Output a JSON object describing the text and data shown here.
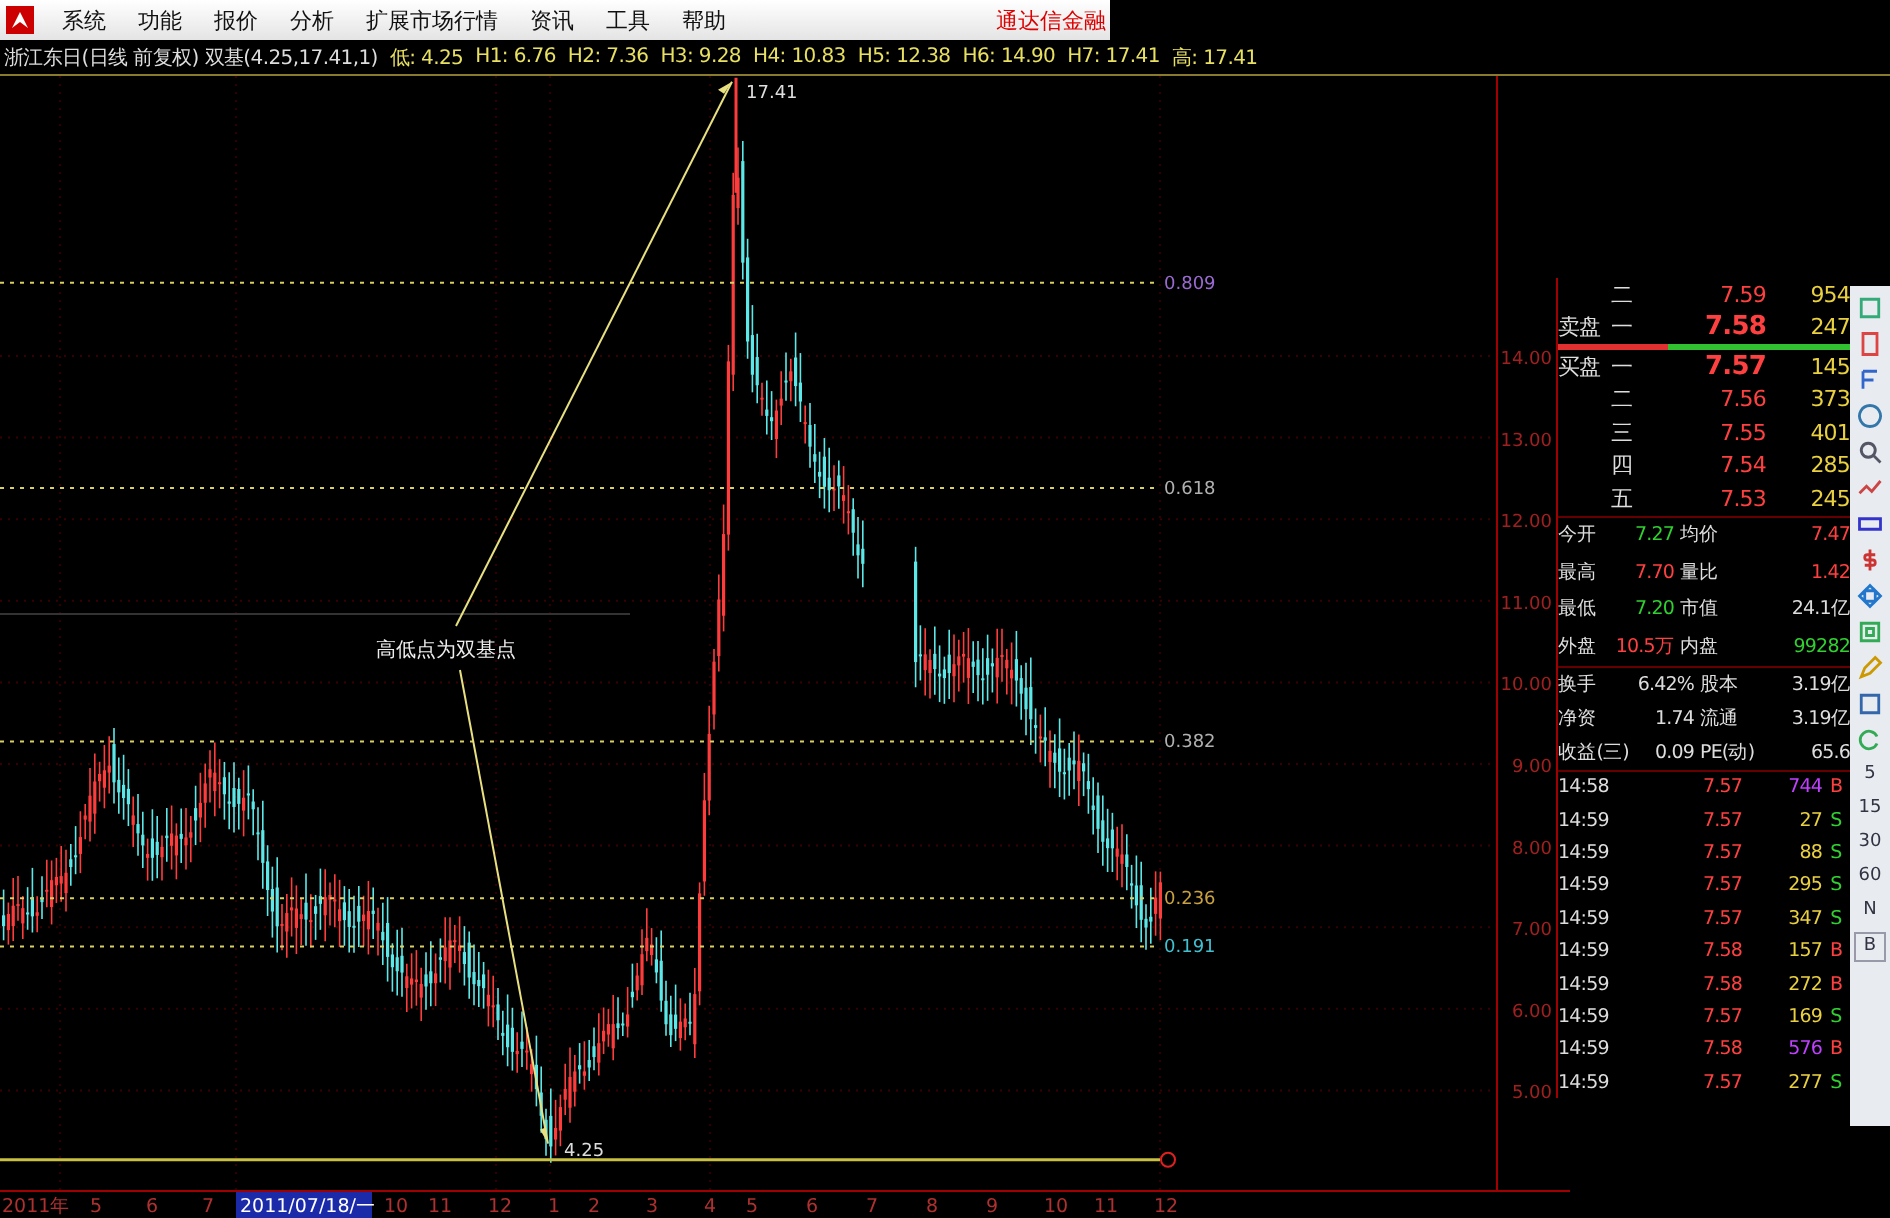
{
  "menu": {
    "items": [
      "系统",
      "功能",
      "报价",
      "分析",
      "扩展市场行情",
      "资讯",
      "工具",
      "帮助"
    ],
    "brand": "通达信金融"
  },
  "info_line": [
    {
      "kind": "title",
      "text": "浙江东日(日线 前复权) 双基(4.25,17.41,1)"
    },
    {
      "kind": "level",
      "text": "低: 4.25"
    },
    {
      "kind": "level",
      "text": "H1: 6.76"
    },
    {
      "kind": "level",
      "text": "H2: 7.36"
    },
    {
      "kind": "level",
      "text": "H3: 9.28"
    },
    {
      "kind": "level",
      "text": "H4: 10.83"
    },
    {
      "kind": "level",
      "text": "H5: 12.38"
    },
    {
      "kind": "level",
      "text": "H6: 14.90"
    },
    {
      "kind": "level",
      "text": "H7: 17.41"
    },
    {
      "kind": "level",
      "text": "高: 17.41"
    }
  ],
  "chart": {
    "high_label": "17.41",
    "low_label": "4.25",
    "annotation": "高低点为双基点",
    "fib_levels": [
      {
        "label": "0.809",
        "color": "#9a6ad0"
      },
      {
        "label": "0.618",
        "color": "#b0b0b0"
      },
      {
        "label": "0.382",
        "color": "#b0b0b0"
      },
      {
        "label": "0.236",
        "color": "#c8a040"
      },
      {
        "label": "0.191",
        "color": "#40c0d0"
      }
    ],
    "price_ticks": [
      "14.00",
      "13.00",
      "12.00",
      "11.00",
      "10.00",
      "9.00",
      "8.00",
      "7.00",
      "6.00",
      "5.00"
    ]
  },
  "order_book": [
    {
      "level": "二",
      "price": "7.59",
      "volume": "954",
      "best": false
    },
    {
      "side_label": "卖盘",
      "level": "一",
      "price": "7.58",
      "volume": "247",
      "best": true
    },
    {
      "side_label": "买盘",
      "level": "一",
      "price": "7.57",
      "volume": "145",
      "best": true
    },
    {
      "level": "二",
      "price": "7.56",
      "volume": "373",
      "best": false
    },
    {
      "level": "三",
      "price": "7.55",
      "volume": "401",
      "best": false
    },
    {
      "level": "四",
      "price": "7.54",
      "volume": "285",
      "best": false
    },
    {
      "level": "五",
      "price": "7.53",
      "volume": "245",
      "best": false
    }
  ],
  "stats": [
    [
      {
        "label": "今开",
        "value": "7.27",
        "color": "#30d030"
      },
      {
        "label": "均价",
        "value": "7.47",
        "color": "#ff4040"
      }
    ],
    [
      {
        "label": "最高",
        "value": "7.70",
        "color": "#ff4040"
      },
      {
        "label": "量比",
        "value": "1.42",
        "color": "#ff4040"
      }
    ],
    [
      {
        "label": "最低",
        "value": "7.20",
        "color": "#30d030"
      },
      {
        "label": "市值",
        "value": "24.1亿",
        "color": "#dddddd"
      }
    ],
    [
      {
        "label": "外盘",
        "value": "10.5万",
        "color": "#ff4040"
      },
      {
        "label": "内盘",
        "value": "99282",
        "color": "#30d030"
      }
    ]
  ],
  "fundamentals": [
    [
      {
        "label": "换手",
        "value": "6.42%"
      },
      {
        "label": "股本",
        "value": "3.19亿"
      }
    ],
    [
      {
        "label": "净资",
        "value": "1.74"
      },
      {
        "label": "流通",
        "value": "3.19亿"
      }
    ],
    [
      {
        "label": "收益(三)",
        "value": "0.09"
      },
      {
        "label": "PE(动)",
        "value": "65.6"
      }
    ]
  ],
  "ticks": [
    {
      "time": "14:58",
      "price": "7.57",
      "volume": "744",
      "large": true,
      "side": "B",
      "kind": "buy"
    },
    {
      "time": "14:59",
      "price": "7.57",
      "volume": "27",
      "large": false,
      "side": "S",
      "kind": "sell"
    },
    {
      "time": "14:59",
      "price": "7.57",
      "volume": "88",
      "large": false,
      "side": "S",
      "kind": "sell"
    },
    {
      "time": "14:59",
      "price": "7.57",
      "volume": "295",
      "large": false,
      "side": "S",
      "kind": "sell"
    },
    {
      "time": "14:59",
      "price": "7.57",
      "volume": "347",
      "large": false,
      "side": "S",
      "kind": "sell"
    },
    {
      "time": "14:59",
      "price": "7.58",
      "volume": "157",
      "large": false,
      "side": "B",
      "kind": "buy"
    },
    {
      "time": "14:59",
      "price": "7.58",
      "volume": "272",
      "large": false,
      "side": "B",
      "kind": "buy"
    },
    {
      "time": "14:59",
      "price": "7.57",
      "volume": "169",
      "large": false,
      "side": "S",
      "kind": "sell"
    },
    {
      "time": "14:59",
      "price": "7.58",
      "volume": "576",
      "large": true,
      "side": "B",
      "kind": "buy"
    },
    {
      "time": "14:59",
      "price": "7.57",
      "volume": "277",
      "large": false,
      "side": "S",
      "kind": "sell"
    }
  ],
  "toolbar_periods": [
    "5",
    "15",
    "30",
    "60",
    "N",
    "B"
  ],
  "date_axis": [
    {
      "text": "2011年",
      "selected": false
    },
    {
      "text": "5",
      "selected": false
    },
    {
      "text": "6",
      "selected": false
    },
    {
      "text": "7",
      "selected": false
    },
    {
      "text": "2011/07/18/一",
      "selected": true
    },
    {
      "text": "10",
      "selected": false
    },
    {
      "text": "11",
      "selected": false
    },
    {
      "text": "12",
      "selected": false
    },
    {
      "text": "1",
      "selected": false
    },
    {
      "text": "2",
      "selected": false
    },
    {
      "text": "3",
      "selected": false
    },
    {
      "text": "4",
      "selected": false
    },
    {
      "text": "5",
      "selected": false
    },
    {
      "text": "6",
      "selected": false
    },
    {
      "text": "7",
      "selected": false
    },
    {
      "text": "8",
      "selected": false
    },
    {
      "text": "9",
      "selected": false
    },
    {
      "text": "10",
      "selected": false
    },
    {
      "text": "11",
      "selected": false
    },
    {
      "text": "12",
      "selected": false
    }
  ]
}
